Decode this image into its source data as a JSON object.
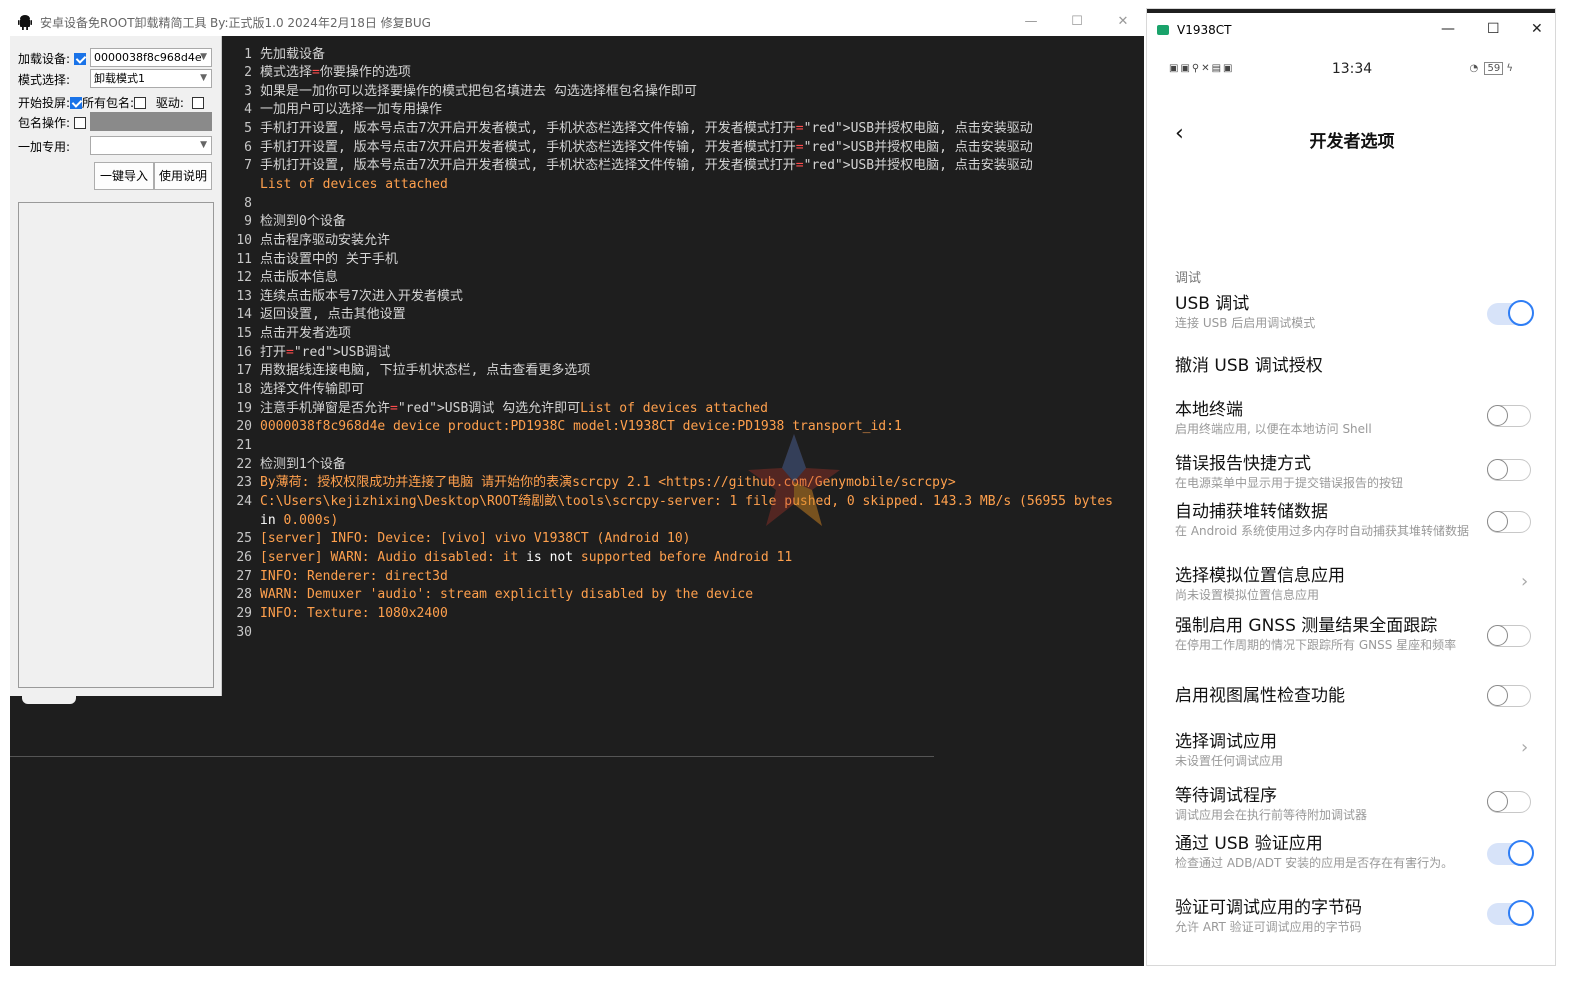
{
  "tool": {
    "title": "安卓设备免ROOT卸载精简工具",
    "subtitle": "By:正式版1.0 2024年2月18日 修复BUG",
    "window_buttons": {
      "minimize": "—",
      "maximize": "☐",
      "close": "✕"
    },
    "form": {
      "device_label": "加载设备:",
      "device_value": "0000038f8c968d4e",
      "mode_label": "模式选择:",
      "mode_value": "卸载模式1",
      "projection_label": "开始投屏:",
      "all_packages_label": "所有包名:",
      "driver_label": "驱动:",
      "package_op_label": "包名操作:",
      "oneplus_label": "一加专用:",
      "import_button": "一键导入",
      "help_button": "使用说明"
    },
    "console_lines": [
      {
        "n": "1",
        "t": "先加载设备"
      },
      {
        "n": "2",
        "t": "模式选择=你要操作的选项"
      },
      {
        "n": "3",
        "t": "如果是一加你可以选择要操作的模式把包名填进去 勾选选择框包名操作即可"
      },
      {
        "n": "4",
        "t": "一加用户可以选择一加专用操作"
      },
      {
        "n": "5",
        "t": "手机打开设置, 版本号点击7次开启开发者模式, 手机状态栏选择文件传输, 开发者模式打开USB并授权电脑, 点击安装驱动"
      },
      {
        "n": "6",
        "t": "手机打开设置, 版本号点击7次开启开发者模式, 手机状态栏选择文件传输, 开发者模式打开USB并授权电脑, 点击安装驱动"
      },
      {
        "n": "7",
        "t": "手机打开设置, 版本号点击7次开启开发者模式, 手机状态栏选择文件传输, 开发者模式打开USB并授权电脑, 点击安装驱动"
      },
      {
        "n": "",
        "t": "List of devices attached"
      },
      {
        "n": "8",
        "t": ""
      },
      {
        "n": "9",
        "t": "检测到0个设备"
      },
      {
        "n": "10",
        "t": "点击程序驱动安装允许"
      },
      {
        "n": "11",
        "t": "点击设置中的 关于手机"
      },
      {
        "n": "12",
        "t": "点击版本信息"
      },
      {
        "n": "13",
        "t": "连续点击版本号7次进入开发者模式"
      },
      {
        "n": "14",
        "t": "返回设置, 点击其他设置"
      },
      {
        "n": "15",
        "t": "点击开发者选项"
      },
      {
        "n": "16",
        "t": "打开USB调试"
      },
      {
        "n": "17",
        "t": "用数据线连接电脑, 下拉手机状态栏, 点击查看更多选项"
      },
      {
        "n": "18",
        "t": "选择文件传输即可"
      },
      {
        "n": "19",
        "t": "注意手机弹窗是否允许USB调试 勾选允许即可List of devices attached"
      },
      {
        "n": "20",
        "t": "0000038f8c968d4e       device product:PD1938C model:V1938CT device:PD1938 transport_id:1"
      },
      {
        "n": "21",
        "t": ""
      },
      {
        "n": "22",
        "t": "检测到1个设备"
      },
      {
        "n": "23",
        "t": "By薄荷: 授权权限成功并连接了电脑 请开始你的表演scrcpy 2.1 <https://github.com/Genymobile/scrcpy>"
      },
      {
        "n": "24",
        "t": "C:\\Users\\kejizhixing\\Desktop\\ROOT绮剧畝\\tools\\scrcpy-server: 1 file pushed, 0 skipped. 143.3 MB/s (56955 bytes"
      },
      {
        "n": "",
        "t": "in 0.000s)"
      },
      {
        "n": "25",
        "t": "[server] INFO: Device: [vivo] vivo V1938CT (Android 10)"
      },
      {
        "n": "26",
        "t": "[server] WARN: Audio disabled: it is not supported before Android 11"
      },
      {
        "n": "27",
        "t": "INFO: Renderer: direct3d"
      },
      {
        "n": "28",
        "t": "WARN: Demuxer 'audio': stream explicitly disabled by the device"
      },
      {
        "n": "29",
        "t": "INFO: Texture: 1080x2400"
      },
      {
        "n": "30",
        "t": ""
      }
    ]
  },
  "phone": {
    "window_title": "V1938CT",
    "window_buttons": {
      "minimize": "—",
      "maximize": "☐",
      "close": "✕"
    },
    "status_time": "13:34",
    "status_battery": "59",
    "page_title": "开发者选项",
    "back_symbol": "‹",
    "section_debug": "调试",
    "items": [
      {
        "title": "USB 调试",
        "sub": "连接 USB 后启用调试模式",
        "control": "on"
      },
      {
        "title": "撤消 USB 调试授权",
        "sub": "",
        "control": "none"
      },
      {
        "title": "本地终端",
        "sub": "启用终端应用, 以便在本地访问 Shell",
        "control": "off"
      },
      {
        "title": "错误报告快捷方式",
        "sub": "在电源菜单中显示用于提交错误报告的按钮",
        "control": "off"
      },
      {
        "title": "自动捕获堆转储数据",
        "sub": "在 Android 系统使用过多内存时自动捕获其堆转储数据",
        "control": "off"
      },
      {
        "title": "选择模拟位置信息应用",
        "sub": "尚未设置模拟位置信息应用",
        "control": "chevron"
      },
      {
        "title": "强制启用 GNSS 测量结果全面跟踪",
        "sub": "在停用工作周期的情况下跟踪所有 GNSS 星座和频率",
        "control": "off"
      },
      {
        "title": "启用视图属性检查功能",
        "sub": "",
        "control": "off"
      },
      {
        "title": "选择调试应用",
        "sub": "未设置任何调试应用",
        "control": "chevron"
      },
      {
        "title": "等待调试程序",
        "sub": "调试应用会在执行前等待附加调试器",
        "control": "off"
      },
      {
        "title": "通过 USB 验证应用",
        "sub": "检查通过 ADB/ADT 安装的应用是否存在有害行为。",
        "control": "on"
      },
      {
        "title": "验证可调试应用的字节码",
        "sub": "允许 ART 验证可调试应用的字节码",
        "control": "on"
      }
    ]
  }
}
